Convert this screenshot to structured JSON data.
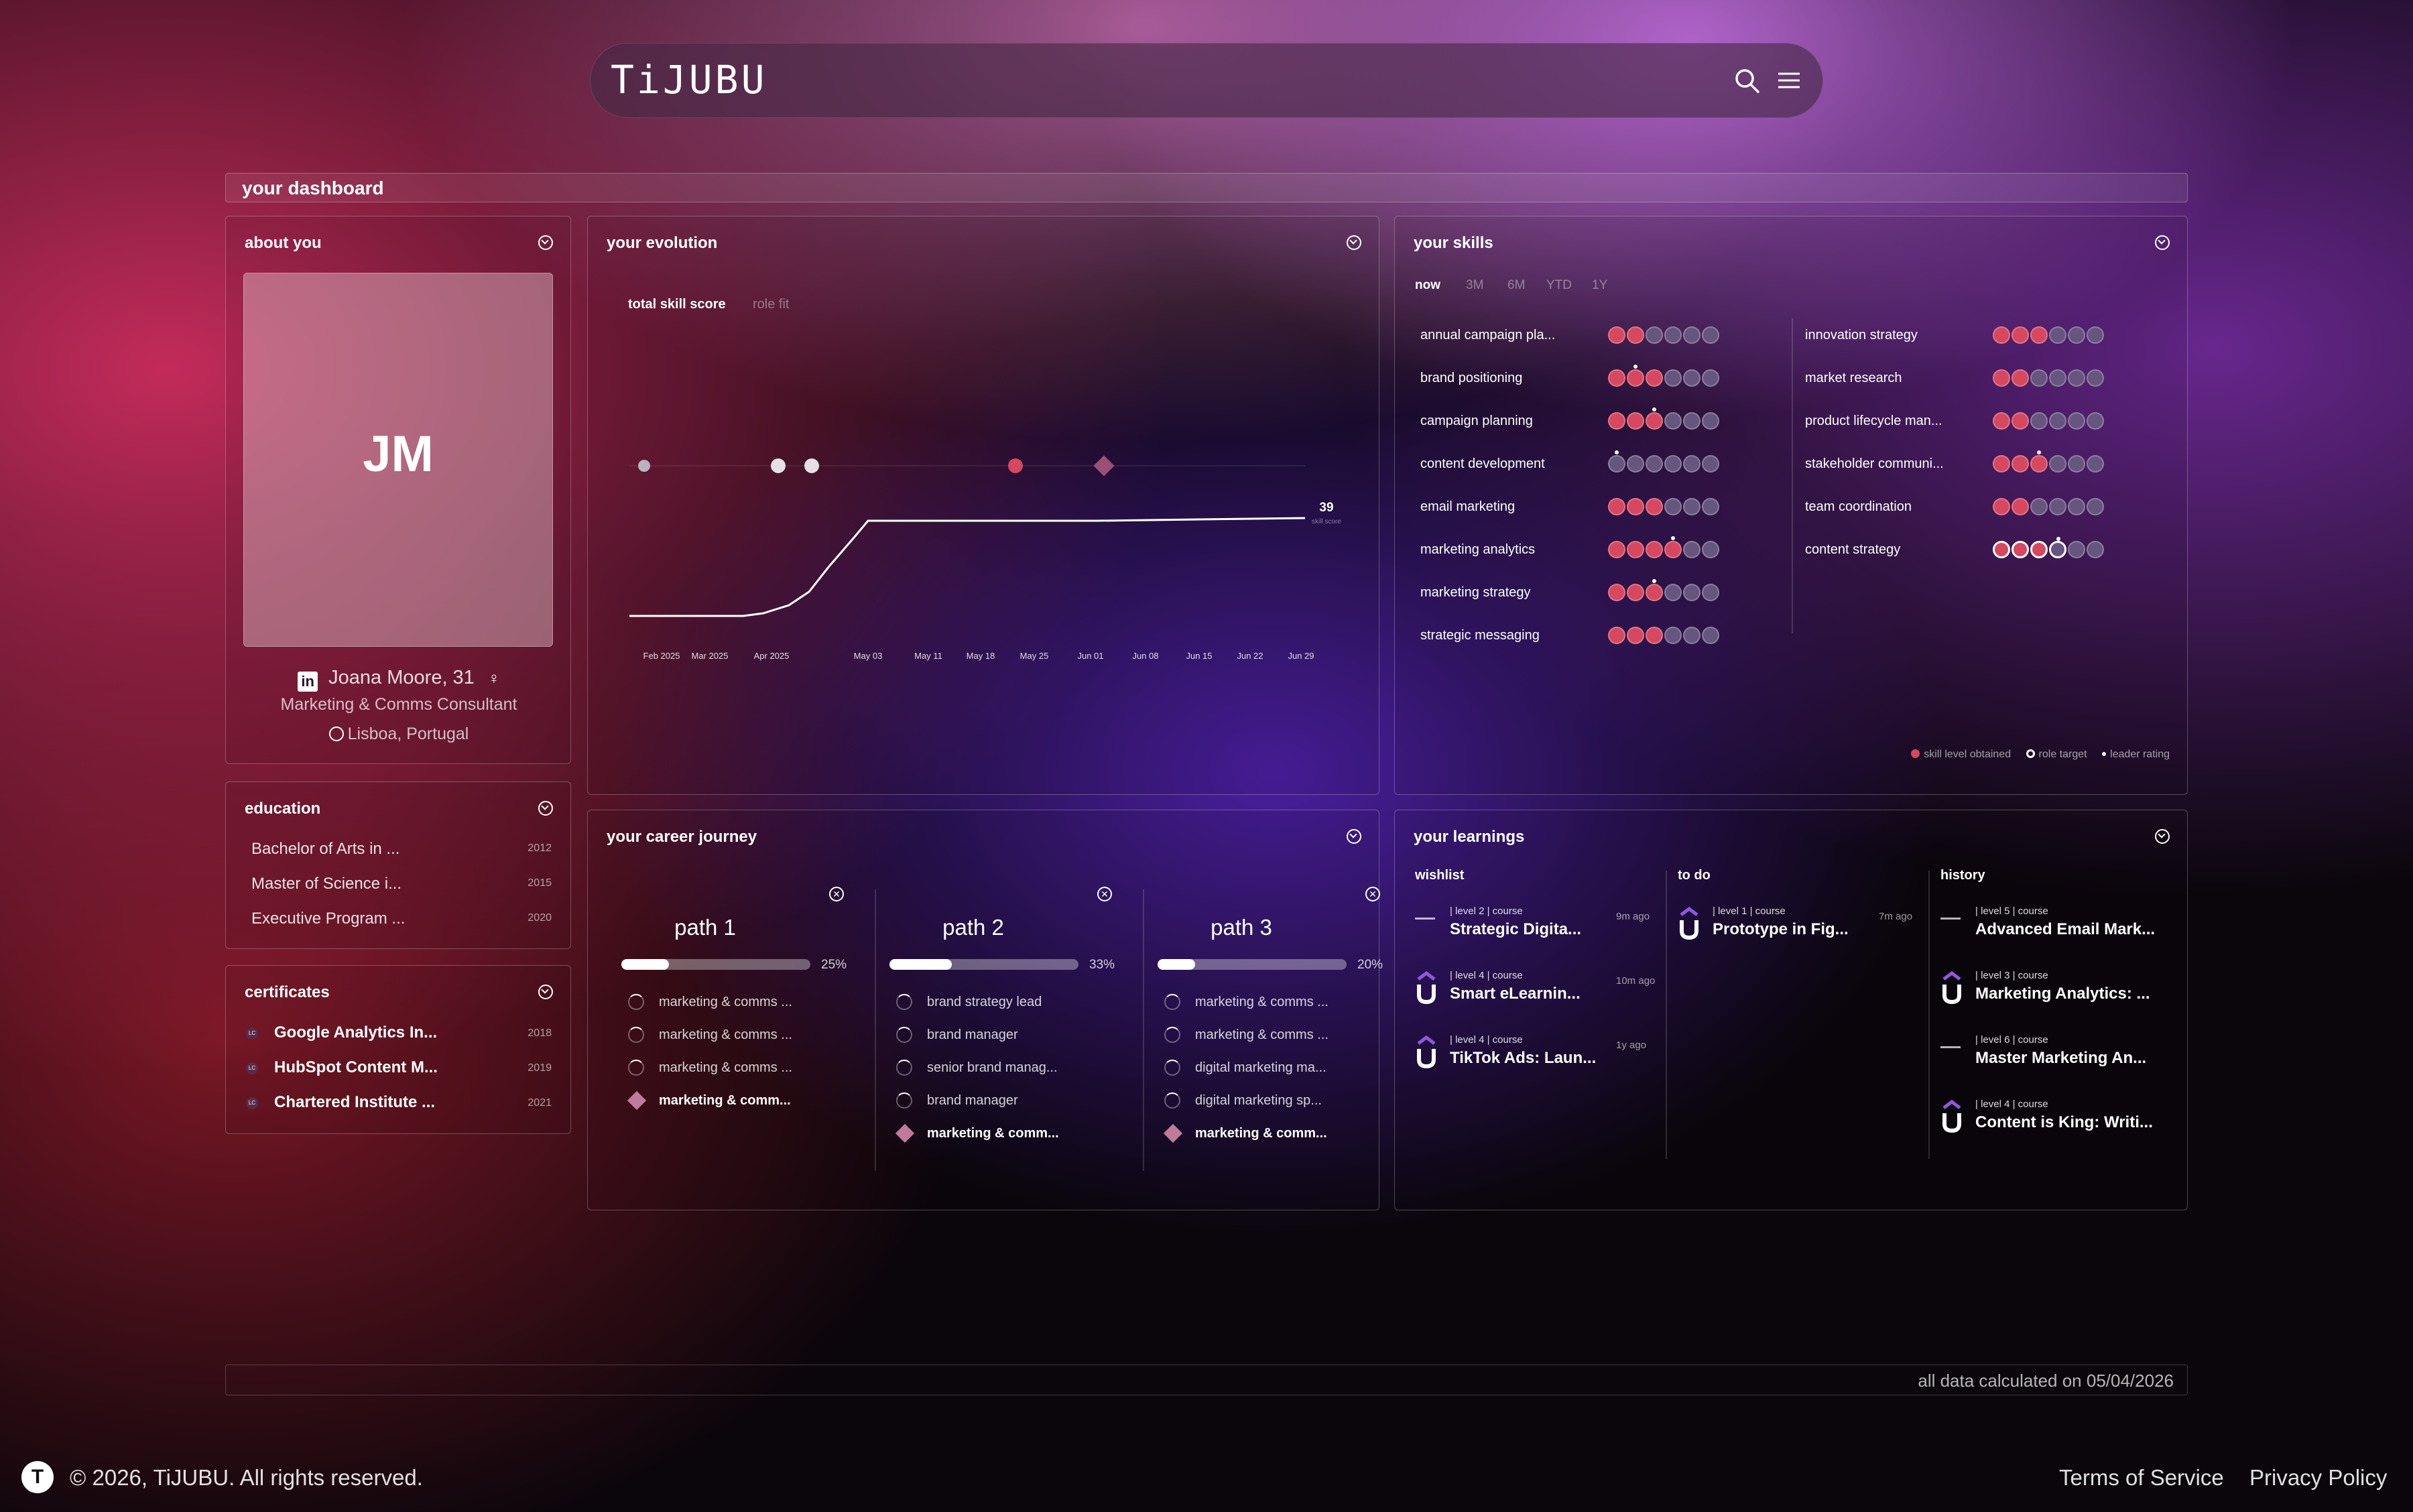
{
  "header": {
    "logo": "TiJUBU"
  },
  "dashboard": {
    "title": "your dashboard"
  },
  "about": {
    "title": "about you",
    "initials": "JM",
    "name": "Joana Moore, 31",
    "role": "Marketing & Comms Consultant",
    "location": "Lisboa, Portugal"
  },
  "education": {
    "title": "education",
    "items": [
      {
        "label": "Bachelor of Arts in ...",
        "year": "2012"
      },
      {
        "label": "Master of Science i...",
        "year": "2015"
      },
      {
        "label": "Executive Program ...",
        "year": "2020"
      }
    ]
  },
  "certificates": {
    "title": "certificates",
    "items": [
      {
        "label": "Google Analytics In...",
        "year": "2018"
      },
      {
        "label": "HubSpot Content M...",
        "year": "2019"
      },
      {
        "label": "Chartered Institute ...",
        "year": "2021"
      }
    ]
  },
  "evolution": {
    "title": "your evolution",
    "tabs": [
      "total skill score",
      "role fit"
    ],
    "active_tab": "total skill score"
  },
  "chart_data": {
    "type": "line",
    "x": [
      "Feb 2025",
      "Mar 2025",
      "Apr 2025",
      "May 03",
      "May 11",
      "May 18",
      "May 25",
      "Jun 01",
      "Jun 08",
      "Jun 15",
      "Jun 22",
      "Jun 29"
    ],
    "series": [
      {
        "values": [
          10,
          10,
          18,
          39,
          39,
          39,
          39,
          39,
          39,
          39,
          39,
          39
        ]
      }
    ],
    "end_label": "39",
    "end_sublabel": "skill score",
    "ylim": [
      0,
      100
    ],
    "event_markers": [
      {
        "x": "Feb 2025",
        "color": "#b9b3bd"
      },
      {
        "x": "Apr 2025",
        "color": "#e3e0e6"
      },
      {
        "x": "Apr 2025 +",
        "color": "#e3e0e6"
      },
      {
        "x": "May 25",
        "color": "#d6485f"
      },
      {
        "x": "Jun 08",
        "color": "#9b4f75"
      }
    ]
  },
  "skills": {
    "title": "your skills",
    "periods": [
      "now",
      "3M",
      "6M",
      "YTD",
      "1Y"
    ],
    "active_period": "now",
    "left": [
      {
        "name": "annual campaign pla...",
        "level": 2,
        "target": 0,
        "leader": 0
      },
      {
        "name": "brand positioning",
        "level": 3,
        "target": 0,
        "leader": 2
      },
      {
        "name": "campaign planning",
        "level": 3,
        "target": 0,
        "leader": 3
      },
      {
        "name": "content development",
        "level": 0,
        "target": 0,
        "leader": 1
      },
      {
        "name": "email marketing",
        "level": 3,
        "target": 0,
        "leader": 0
      },
      {
        "name": "marketing analytics",
        "level": 4,
        "target": 0,
        "leader": 4
      },
      {
        "name": "marketing strategy",
        "level": 3,
        "target": 0,
        "leader": 3
      },
      {
        "name": "strategic messaging",
        "level": 3,
        "target": 0,
        "leader": 0
      }
    ],
    "right": [
      {
        "name": "innovation strategy",
        "level": 3,
        "target": 0,
        "leader": 0
      },
      {
        "name": "market research",
        "level": 2,
        "target": 0,
        "leader": 0
      },
      {
        "name": "product lifecycle man...",
        "level": 2,
        "target": 0,
        "leader": 0
      },
      {
        "name": "stakeholder communi...",
        "level": 3,
        "target": 0,
        "leader": 3
      },
      {
        "name": "team coordination",
        "level": 2,
        "target": 0,
        "leader": 0
      },
      {
        "name": "content strategy",
        "level": 3,
        "target": 4,
        "leader": 4
      }
    ],
    "legend": [
      "skill level obtained",
      "role target",
      "leader rating"
    ]
  },
  "career": {
    "title": "your career journey",
    "paths": [
      {
        "name": "path 1",
        "progress": 25,
        "progress_label": "25%",
        "items": [
          "marketing & comms ...",
          "marketing & comms ...",
          "marketing & comms ..."
        ],
        "goal": "marketing & comm..."
      },
      {
        "name": "path 2",
        "progress": 33,
        "progress_label": "33%",
        "items": [
          "brand strategy lead",
          "brand manager",
          "senior brand manag...",
          "brand manager"
        ],
        "goal": "marketing & comm..."
      },
      {
        "name": "path 3",
        "progress": 20,
        "progress_label": "20%",
        "items": [
          "marketing & comms ...",
          "marketing & comms ...",
          "digital marketing ma...",
          "digital marketing sp..."
        ],
        "goal": "marketing & comm..."
      }
    ]
  },
  "learnings": {
    "title": "your learnings",
    "columns": [
      {
        "title": "wishlist",
        "items": [
          {
            "meta": "| level 2 | course",
            "title": "Strategic Digita...",
            "ago": "9m ago",
            "logo": "text"
          },
          {
            "meta": "| level 4 | course",
            "title": "Smart eLearnin...",
            "ago": "10m ago",
            "logo": "u"
          },
          {
            "meta": "| level 4 | course",
            "title": "TikTok Ads: Laun...",
            "ago": "1y ago",
            "logo": "u"
          }
        ]
      },
      {
        "title": "to do",
        "items": [
          {
            "meta": "| level 1 | course",
            "title": "Prototype in Fig...",
            "ago": "7m ago",
            "logo": "u"
          }
        ]
      },
      {
        "title": "history",
        "items": [
          {
            "meta": "| level 5 | course",
            "title": "Advanced Email Mark...",
            "ago": "",
            "logo": "text"
          },
          {
            "meta": "| level 3 | course",
            "title": "Marketing Analytics: ...",
            "ago": "",
            "logo": "u"
          },
          {
            "meta": "| level 6 | course",
            "title": "Master Marketing An...",
            "ago": "",
            "logo": "text"
          },
          {
            "meta": "| level 4 | course",
            "title": "Content is King: Writi...",
            "ago": "",
            "logo": "u"
          }
        ]
      }
    ]
  },
  "status": {
    "calculated": "all data calculated on 05/04/2026"
  },
  "footer": {
    "badge": "T",
    "copyright": "© 2026, TiJUBU. All rights reserved.",
    "terms": "Terms of Service",
    "privacy": "Privacy Policy"
  },
  "colors": {
    "accent": "#d6485f",
    "skill_off": "#66557e",
    "u_logo": "#8a5ae0"
  }
}
